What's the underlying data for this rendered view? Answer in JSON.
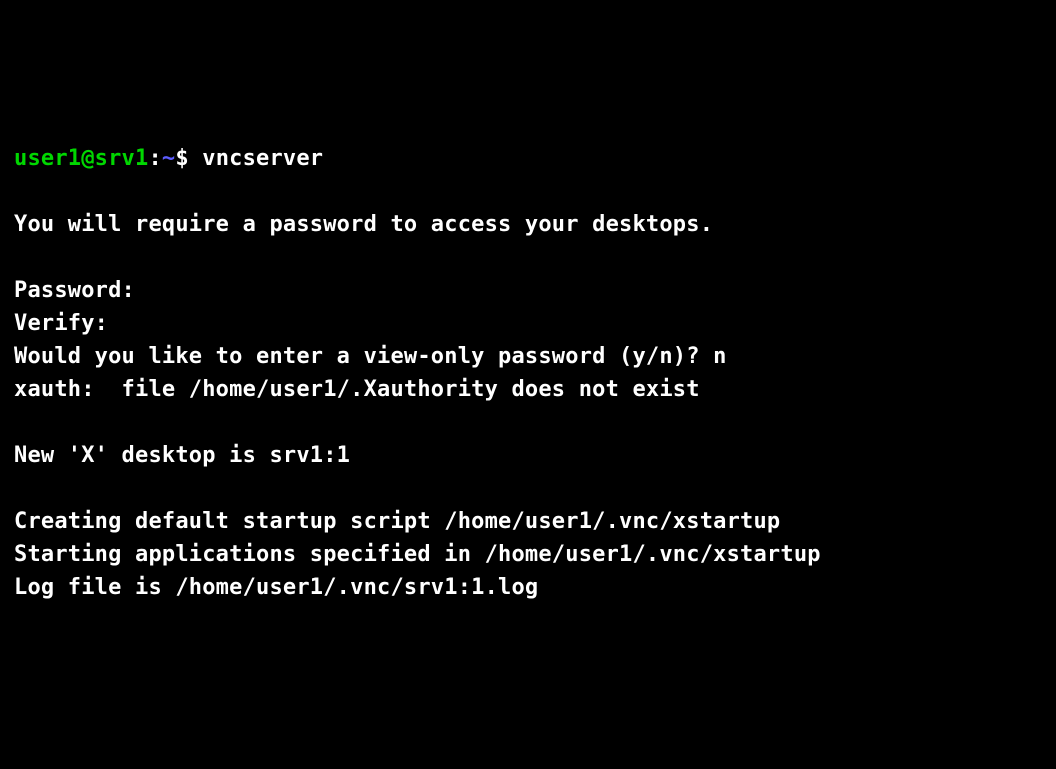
{
  "prompt": {
    "userhost": "user1@srv1",
    "separator": ":",
    "path": "~",
    "symbol": "$ "
  },
  "command": "vncserver",
  "output": {
    "blank1": "",
    "require_password": "You will require a password to access your desktops.",
    "blank2": "",
    "password_prompt": "Password:",
    "verify_prompt": "Verify:",
    "view_only_question": "Would you like to enter a view-only password (y/n)? n",
    "xauth_message": "xauth:  file /home/user1/.Xauthority does not exist",
    "blank3": "",
    "new_desktop": "New 'X' desktop is srv1:1",
    "blank4": "",
    "creating_startup": "Creating default startup script /home/user1/.vnc/xstartup",
    "starting_apps": "Starting applications specified in /home/user1/.vnc/xstartup",
    "log_file": "Log file is /home/user1/.vnc/srv1:1.log"
  }
}
